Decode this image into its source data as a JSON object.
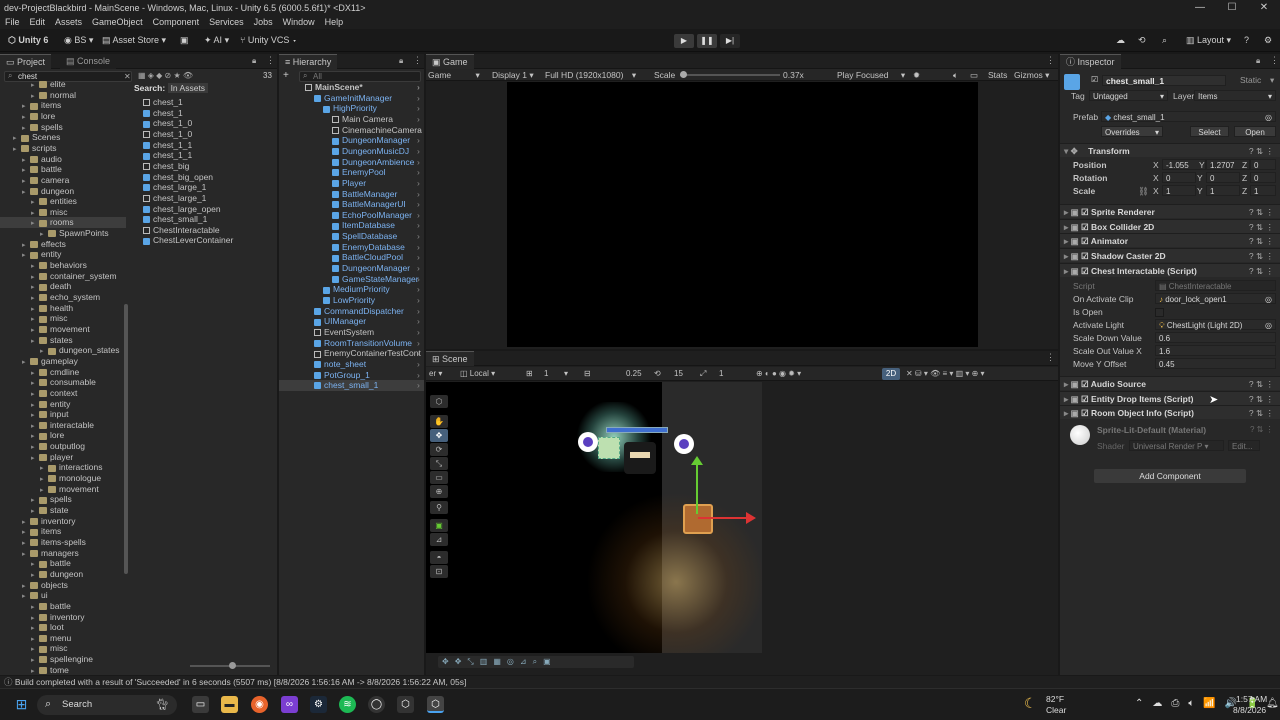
{
  "window": {
    "title": "dev-ProjectBlackbird - MainScene - Windows, Mac, Linux - Unity 6.5 (6000.5.6f1)* <DX11>",
    "min": "—",
    "max": "☐",
    "close": "✕"
  },
  "menu": [
    "File",
    "Edit",
    "Assets",
    "GameObject",
    "Component",
    "Services",
    "Jobs",
    "Window",
    "Help"
  ],
  "toolbar": {
    "unity": "Unity 6",
    "account": "BS",
    "asset_store": "Asset Store",
    "ai": "AI",
    "vcs": "Unity VCS",
    "layout": "Layout"
  },
  "project_panel": {
    "tabs": [
      "Project",
      "Console"
    ],
    "search_value": "chest",
    "count": "33",
    "search_label": "Search:",
    "search_scope": "In Assets",
    "tree": [
      {
        "label": "elite",
        "indent": 3,
        "type": "folder"
      },
      {
        "label": "normal",
        "indent": 3,
        "type": "folder"
      },
      {
        "label": "items",
        "indent": 2,
        "type": "folder"
      },
      {
        "label": "lore",
        "indent": 2,
        "type": "folder"
      },
      {
        "label": "spells",
        "indent": 2,
        "type": "folder"
      },
      {
        "label": "Scenes",
        "indent": 1,
        "type": "folder"
      },
      {
        "label": "scripts",
        "indent": 1,
        "type": "folder"
      },
      {
        "label": "audio",
        "indent": 2,
        "type": "folder"
      },
      {
        "label": "battle",
        "indent": 2,
        "type": "folder"
      },
      {
        "label": "camera",
        "indent": 2,
        "type": "folder"
      },
      {
        "label": "dungeon",
        "indent": 2,
        "type": "folder"
      },
      {
        "label": "entities",
        "indent": 3,
        "type": "folder"
      },
      {
        "label": "misc",
        "indent": 3,
        "type": "folder"
      },
      {
        "label": "rooms",
        "indent": 3,
        "type": "folder",
        "selected": true
      },
      {
        "label": "SpawnPoints",
        "indent": 4,
        "type": "folder"
      },
      {
        "label": "effects",
        "indent": 2,
        "type": "folder"
      },
      {
        "label": "entity",
        "indent": 2,
        "type": "folder"
      },
      {
        "label": "behaviors",
        "indent": 3,
        "type": "folder"
      },
      {
        "label": "container_system",
        "indent": 3,
        "type": "folder"
      },
      {
        "label": "death",
        "indent": 3,
        "type": "folder"
      },
      {
        "label": "echo_system",
        "indent": 3,
        "type": "folder"
      },
      {
        "label": "health",
        "indent": 3,
        "type": "folder"
      },
      {
        "label": "misc",
        "indent": 3,
        "type": "folder"
      },
      {
        "label": "movement",
        "indent": 3,
        "type": "folder"
      },
      {
        "label": "states",
        "indent": 3,
        "type": "folder"
      },
      {
        "label": "dungeon_states",
        "indent": 4,
        "type": "folder"
      },
      {
        "label": "gameplay",
        "indent": 2,
        "type": "folder"
      },
      {
        "label": "cmdline",
        "indent": 3,
        "type": "folder"
      },
      {
        "label": "consumable",
        "indent": 3,
        "type": "folder"
      },
      {
        "label": "context",
        "indent": 3,
        "type": "folder"
      },
      {
        "label": "entity",
        "indent": 3,
        "type": "folder"
      },
      {
        "label": "input",
        "indent": 3,
        "type": "folder"
      },
      {
        "label": "interactable",
        "indent": 3,
        "type": "folder"
      },
      {
        "label": "lore",
        "indent": 3,
        "type": "folder"
      },
      {
        "label": "outputlog",
        "indent": 3,
        "type": "folder"
      },
      {
        "label": "player",
        "indent": 3,
        "type": "folder"
      },
      {
        "label": "interactions",
        "indent": 4,
        "type": "folder"
      },
      {
        "label": "monologue",
        "indent": 4,
        "type": "folder"
      },
      {
        "label": "movement",
        "indent": 4,
        "type": "folder"
      },
      {
        "label": "spells",
        "indent": 3,
        "type": "folder"
      },
      {
        "label": "state",
        "indent": 3,
        "type": "folder"
      },
      {
        "label": "inventory",
        "indent": 2,
        "type": "folder"
      },
      {
        "label": "items",
        "indent": 2,
        "type": "folder"
      },
      {
        "label": "items-spells",
        "indent": 2,
        "type": "folder"
      },
      {
        "label": "managers",
        "indent": 2,
        "type": "folder"
      },
      {
        "label": "battle",
        "indent": 3,
        "type": "folder"
      },
      {
        "label": "dungeon",
        "indent": 3,
        "type": "folder"
      },
      {
        "label": "objects",
        "indent": 2,
        "type": "folder"
      },
      {
        "label": "ui",
        "indent": 2,
        "type": "folder"
      },
      {
        "label": "battle",
        "indent": 3,
        "type": "folder"
      },
      {
        "label": "inventory",
        "indent": 3,
        "type": "folder"
      },
      {
        "label": "loot",
        "indent": 3,
        "type": "folder"
      },
      {
        "label": "menu",
        "indent": 3,
        "type": "folder"
      },
      {
        "label": "misc",
        "indent": 3,
        "type": "folder"
      },
      {
        "label": "spellengine",
        "indent": 3,
        "type": "folder"
      },
      {
        "label": "tome",
        "indent": 3,
        "type": "folder"
      }
    ],
    "results": [
      "chest_1",
      "chest_1",
      "chest_1_0",
      "chest_1_0",
      "chest_1_1",
      "chest_1_1",
      "chest_big",
      "chest_big_open",
      "chest_large_1",
      "chest_large_1",
      "chest_large_open",
      "chest_small_1",
      "ChestInteractable",
      "ChestLeverContainer"
    ]
  },
  "hierarchy": {
    "tab": "Hierarchy",
    "search_placeholder": "All",
    "rows": [
      {
        "label": "MainScene*",
        "indent": 0,
        "bold": true
      },
      {
        "label": "GameInitManager",
        "indent": 1,
        "blue": true
      },
      {
        "label": "HighPriority",
        "indent": 2,
        "blue": true
      },
      {
        "label": "Main Camera",
        "indent": 3
      },
      {
        "label": "CinemachineCamera",
        "indent": 3
      },
      {
        "label": "DungeonManager",
        "indent": 3,
        "blue": true
      },
      {
        "label": "DungeonMusicDJ",
        "indent": 3,
        "blue": true
      },
      {
        "label": "DungeonAmbience",
        "indent": 3,
        "blue": true
      },
      {
        "label": "EnemyPool",
        "indent": 3,
        "blue": true
      },
      {
        "label": "Player",
        "indent": 3,
        "blue": true
      },
      {
        "label": "BattleManager",
        "indent": 3,
        "blue": true
      },
      {
        "label": "BattleManagerUI",
        "indent": 3,
        "blue": true
      },
      {
        "label": "EchoPoolManager",
        "indent": 3,
        "blue": true
      },
      {
        "label": "ItemDatabase",
        "indent": 3,
        "blue": true
      },
      {
        "label": "SpellDatabase",
        "indent": 3,
        "blue": true
      },
      {
        "label": "EnemyDatabase",
        "indent": 3,
        "blue": true
      },
      {
        "label": "BattleCloudPool",
        "indent": 3,
        "blue": true
      },
      {
        "label": "DungeonManager",
        "indent": 3,
        "blue": true
      },
      {
        "label": "GameStateManager",
        "indent": 3,
        "blue": true
      },
      {
        "label": "MediumPriority",
        "indent": 2,
        "blue": true
      },
      {
        "label": "LowPriority",
        "indent": 2,
        "blue": true
      },
      {
        "label": "CommandDispatcher",
        "indent": 1,
        "blue": true
      },
      {
        "label": "UIManager",
        "indent": 1,
        "blue": true
      },
      {
        "label": "EventSystem",
        "indent": 1
      },
      {
        "label": "RoomTransitionVolume",
        "indent": 1,
        "blue": true
      },
      {
        "label": "EnemyContainerTestCont",
        "indent": 1
      },
      {
        "label": "note_sheet",
        "indent": 1,
        "blue": true
      },
      {
        "label": "PotGroup_1",
        "indent": 1,
        "blue": true
      },
      {
        "label": "chest_small_1",
        "indent": 1,
        "blue": true,
        "selected": true
      }
    ]
  },
  "game_view": {
    "tab": "Game",
    "mode": "Game",
    "display": "Display 1",
    "resolution": "Full HD (1920x1080)",
    "scale_label": "Scale",
    "scale_value": "0.37x",
    "play_focused": "Play Focused",
    "stats": "Stats",
    "gizmos": "Gizmos"
  },
  "scene_view": {
    "tab": "Scene",
    "pivot": "er",
    "space": "Local",
    "snap_value": "1",
    "grid_value": "0.25",
    "angle_value": "15",
    "scale_snap": "1",
    "mode_2d": "2D"
  },
  "inspector": {
    "tab": "Inspector",
    "object_name": "chest_small_1",
    "static_label": "Static",
    "tag_label": "Tag",
    "tag_value": "Untagged",
    "layer_label": "Layer",
    "layer_value": "Items",
    "prefab_label": "Prefab",
    "prefab_value": "chest_small_1",
    "overrides": "Overrides",
    "select": "Select",
    "open": "Open",
    "transform": {
      "title": "Transform",
      "position_label": "Position",
      "pos_x": "-1.055",
      "pos_y": "1.2707",
      "pos_z": "0",
      "rotation_label": "Rotation",
      "rot_x": "0",
      "rot_y": "0",
      "rot_z": "0",
      "scale_label": "Scale",
      "scl_x": "1",
      "scl_y": "1",
      "scl_z": "1"
    },
    "components": [
      "Sprite Renderer",
      "Box Collider 2D",
      "Animator",
      "Shadow Caster 2D",
      "Chest Interactable (Script)"
    ],
    "chest_fields": {
      "script_label": "Script",
      "script_value": "ChestInteractable",
      "clip_label": "On Activate Clip",
      "clip_value": "door_lock_open1",
      "isopen_label": "Is Open",
      "light_label": "Activate Light",
      "light_value": "ChestLight (Light 2D)",
      "sdown_label": "Scale Down Value",
      "sdown_value": "0.6",
      "sout_label": "Scale Out Value X",
      "sout_value": "1.6",
      "movey_label": "Move Y Offset",
      "movey_value": "0.45"
    },
    "components2": [
      "Audio Source",
      "Entity Drop Items (Script)",
      "Room Object Info (Script)"
    ],
    "material_name": "Sprite-Lit-Default (Material)",
    "shader_label": "Shader",
    "shader_value": "Universal Render P",
    "edit": "Edit...",
    "add_component": "Add Component"
  },
  "status": "Build completed with a result of 'Succeeded' in 6 seconds (5507 ms) [8/8/2026 1:56:16 AM -> 8/8/2026 1:56:22 AM, 05s]",
  "taskbar": {
    "search": "Search",
    "weather_temp": "82°F",
    "weather_desc": "Clear",
    "time": "1:57 AM",
    "date": "8/8/2026"
  }
}
